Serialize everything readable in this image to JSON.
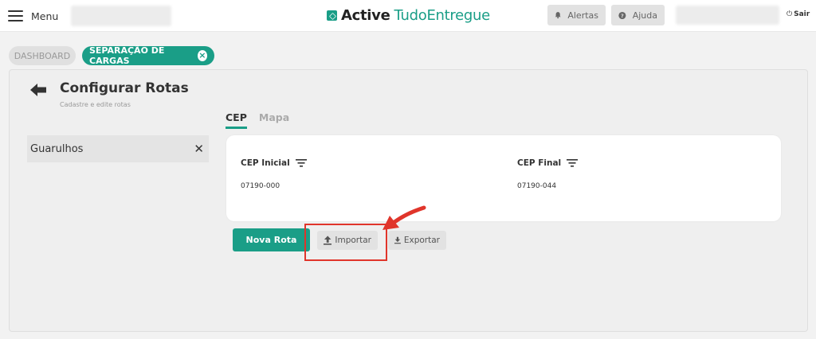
{
  "header": {
    "menu_label": "Menu",
    "logo_bold": "Active",
    "logo_light": "TudoEntregue",
    "alerts_label": "Alertas",
    "help_label": "Ajuda",
    "logout_label": "Sair"
  },
  "breadcrumbs": {
    "dashboard": "DASHBOARD",
    "current": "SEPARAÇÃO DE CARGAS"
  },
  "page": {
    "title": "Configurar Rotas",
    "subtitle": "Cadastre e edite rotas"
  },
  "tabs": [
    {
      "label": "CEP",
      "active": true
    },
    {
      "label": "Mapa",
      "active": false
    }
  ],
  "regions": [
    {
      "name": "Guarulhos"
    }
  ],
  "table": {
    "columns": [
      "CEP Inicial",
      "CEP Final"
    ],
    "rows": [
      [
        "07190-000",
        "07190-044"
      ]
    ]
  },
  "actions": {
    "new_route": "Nova Rota",
    "import": "Importar",
    "export": "Exportar"
  },
  "colors": {
    "brand": "#1a9e87",
    "annotation": "#e0352b"
  }
}
